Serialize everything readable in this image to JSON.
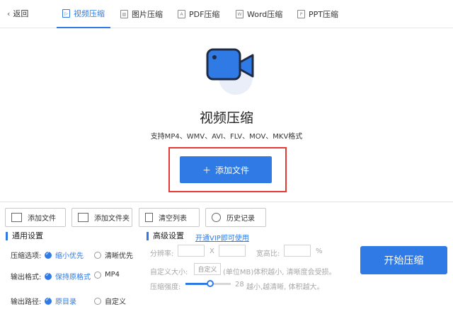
{
  "nav": {
    "back_label": "返回",
    "tabs": [
      {
        "label": "视频压缩",
        "icon": "video-icon",
        "active": true
      },
      {
        "label": "图片压缩",
        "icon": "image-icon",
        "active": false
      },
      {
        "label": "PDF压缩",
        "icon": "pdf-icon",
        "active": false
      },
      {
        "label": "Word压缩",
        "icon": "word-icon",
        "active": false
      },
      {
        "label": "PPT压缩",
        "icon": "ppt-icon",
        "active": false
      }
    ]
  },
  "hero": {
    "title": "视频压缩",
    "formats": "支持MP4、WMV、AVI、FLV、MOV、MKV格式",
    "add_file_label": "添加文件"
  },
  "toolbar": {
    "add_file": "添加文件",
    "add_folder": "添加文件夹",
    "clear_list": "清空列表",
    "history": "历史记录"
  },
  "general": {
    "title": "通用设置",
    "compress_option_label": "压缩选项:",
    "compress_options": [
      {
        "label": "缩小优先",
        "selected": true
      },
      {
        "label": "清晰优先",
        "selected": false
      }
    ],
    "output_format_label": "输出格式:",
    "output_formats": [
      {
        "label": "保持原格式",
        "selected": true
      },
      {
        "label": "MP4",
        "selected": false
      }
    ],
    "output_path_label": "输出路径:",
    "output_paths": [
      {
        "label": "原目录",
        "selected": true
      },
      {
        "label": "自定义",
        "selected": false
      }
    ]
  },
  "advanced": {
    "title": "高级设置",
    "vip_link": "开通VIP即可使用",
    "resolution_label": "分辨率:",
    "resolution_x": "X",
    "aspect_label": "宽高比:",
    "aspect_unit": "%",
    "custom_size_label": "自定义大小:",
    "custom_size_btn": "自定义",
    "custom_size_hint": "(单位MB)体积越小, 清晰度会受损。",
    "strength_label": "压缩强度:",
    "strength_value": "28",
    "strength_hint": "越小,越清晰, 体积越大。",
    "strength_fraction": 0.55
  },
  "start_label": "开始压缩",
  "colors": {
    "accent": "#2f7ae5",
    "highlight_box": "#e53935"
  }
}
